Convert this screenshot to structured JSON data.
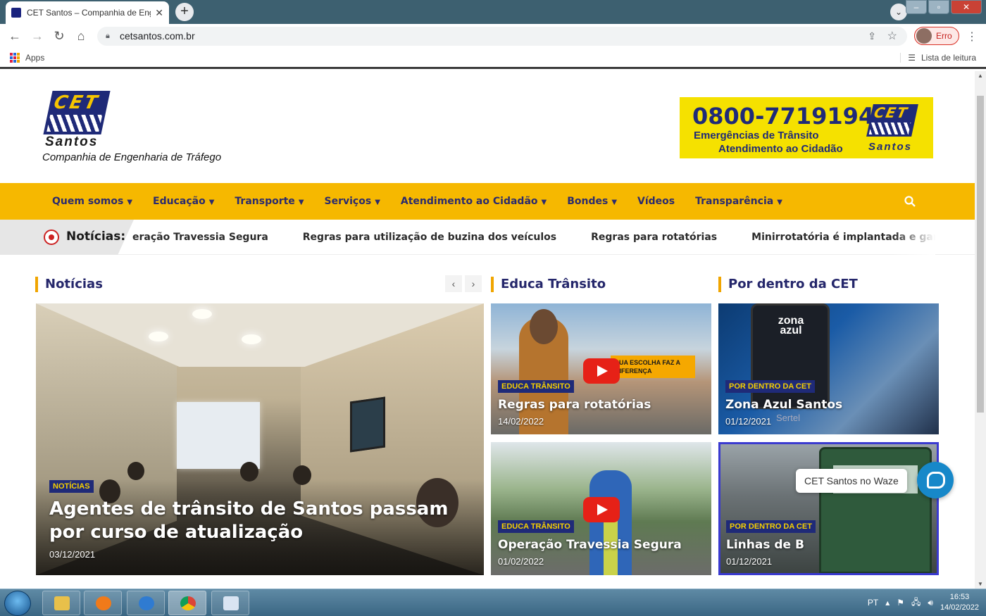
{
  "browser": {
    "tab_title": "CET Santos – Companhia de Engenharia de Tráfego",
    "tab_close": "✕",
    "new_tab": "+",
    "url": "cetsantos.com.br",
    "profile_label": "Erro",
    "bookmarks_apps": "Apps",
    "reading_list": "Lista de leitura"
  },
  "header": {
    "logo_mark": "CET",
    "logo_city": "Santos",
    "logo_full": "Companhia de Engenharia de Tráfego",
    "banner_phone": "0800-7719194",
    "banner_line1": "Emergências de Trânsito",
    "banner_line2": "Atendimento ao Cidadão",
    "banner_mark": "CET",
    "banner_city": "Santos"
  },
  "menu": {
    "items": [
      {
        "label": "Quem somos",
        "dropdown": true
      },
      {
        "label": "Educação",
        "dropdown": true
      },
      {
        "label": "Transporte",
        "dropdown": true
      },
      {
        "label": "Serviços",
        "dropdown": true
      },
      {
        "label": "Atendimento ao Cidadão",
        "dropdown": true
      },
      {
        "label": "Bondes",
        "dropdown": true
      },
      {
        "label": "Vídeos",
        "dropdown": false
      },
      {
        "label": "Transparência",
        "dropdown": true
      }
    ],
    "caret": "▼"
  },
  "ticker": {
    "label": "Notícias:",
    "items": [
      "eração Travessia Segura",
      "Regras para utilização de buzina dos veículos",
      "Regras para rotatórias",
      "Minirrotatória é implantada e garante mais s"
    ]
  },
  "sections": {
    "news": "Notícias",
    "educa": "Educa Trânsito",
    "dentro": "Por dentro da CET",
    "prev": "‹",
    "next": "›"
  },
  "cards": {
    "main": {
      "category": "NOTÍCIAS",
      "title": "Agentes de trânsito de Santos passam por curso de atualização",
      "date": "03/12/2021"
    },
    "educa1": {
      "category": "EDUCA TRÂNSITO",
      "title": "Regras para rotatórias",
      "date": "14/02/2022",
      "overlay": "SUA ESCOLHA FAZ A DIFERENÇA"
    },
    "educa2": {
      "category": "EDUCA TRÂNSITO",
      "title": "Operação Travessia Segura",
      "date": "01/02/2022"
    },
    "dentro1": {
      "category": "POR DENTRO DA CET",
      "title": "Zona Azul Santos",
      "date": "01/12/2021",
      "overlay": "zona azul",
      "watermark": "Sertel"
    },
    "dentro2": {
      "category": "POR DENTRO DA CET",
      "title": "Linhas de B",
      "date": "01/12/2021"
    }
  },
  "widget": {
    "waze_label": "CET Santos no Waze"
  },
  "taskbar": {
    "lang": "PT",
    "time": "16:53",
    "date": "14/02/2022"
  }
}
